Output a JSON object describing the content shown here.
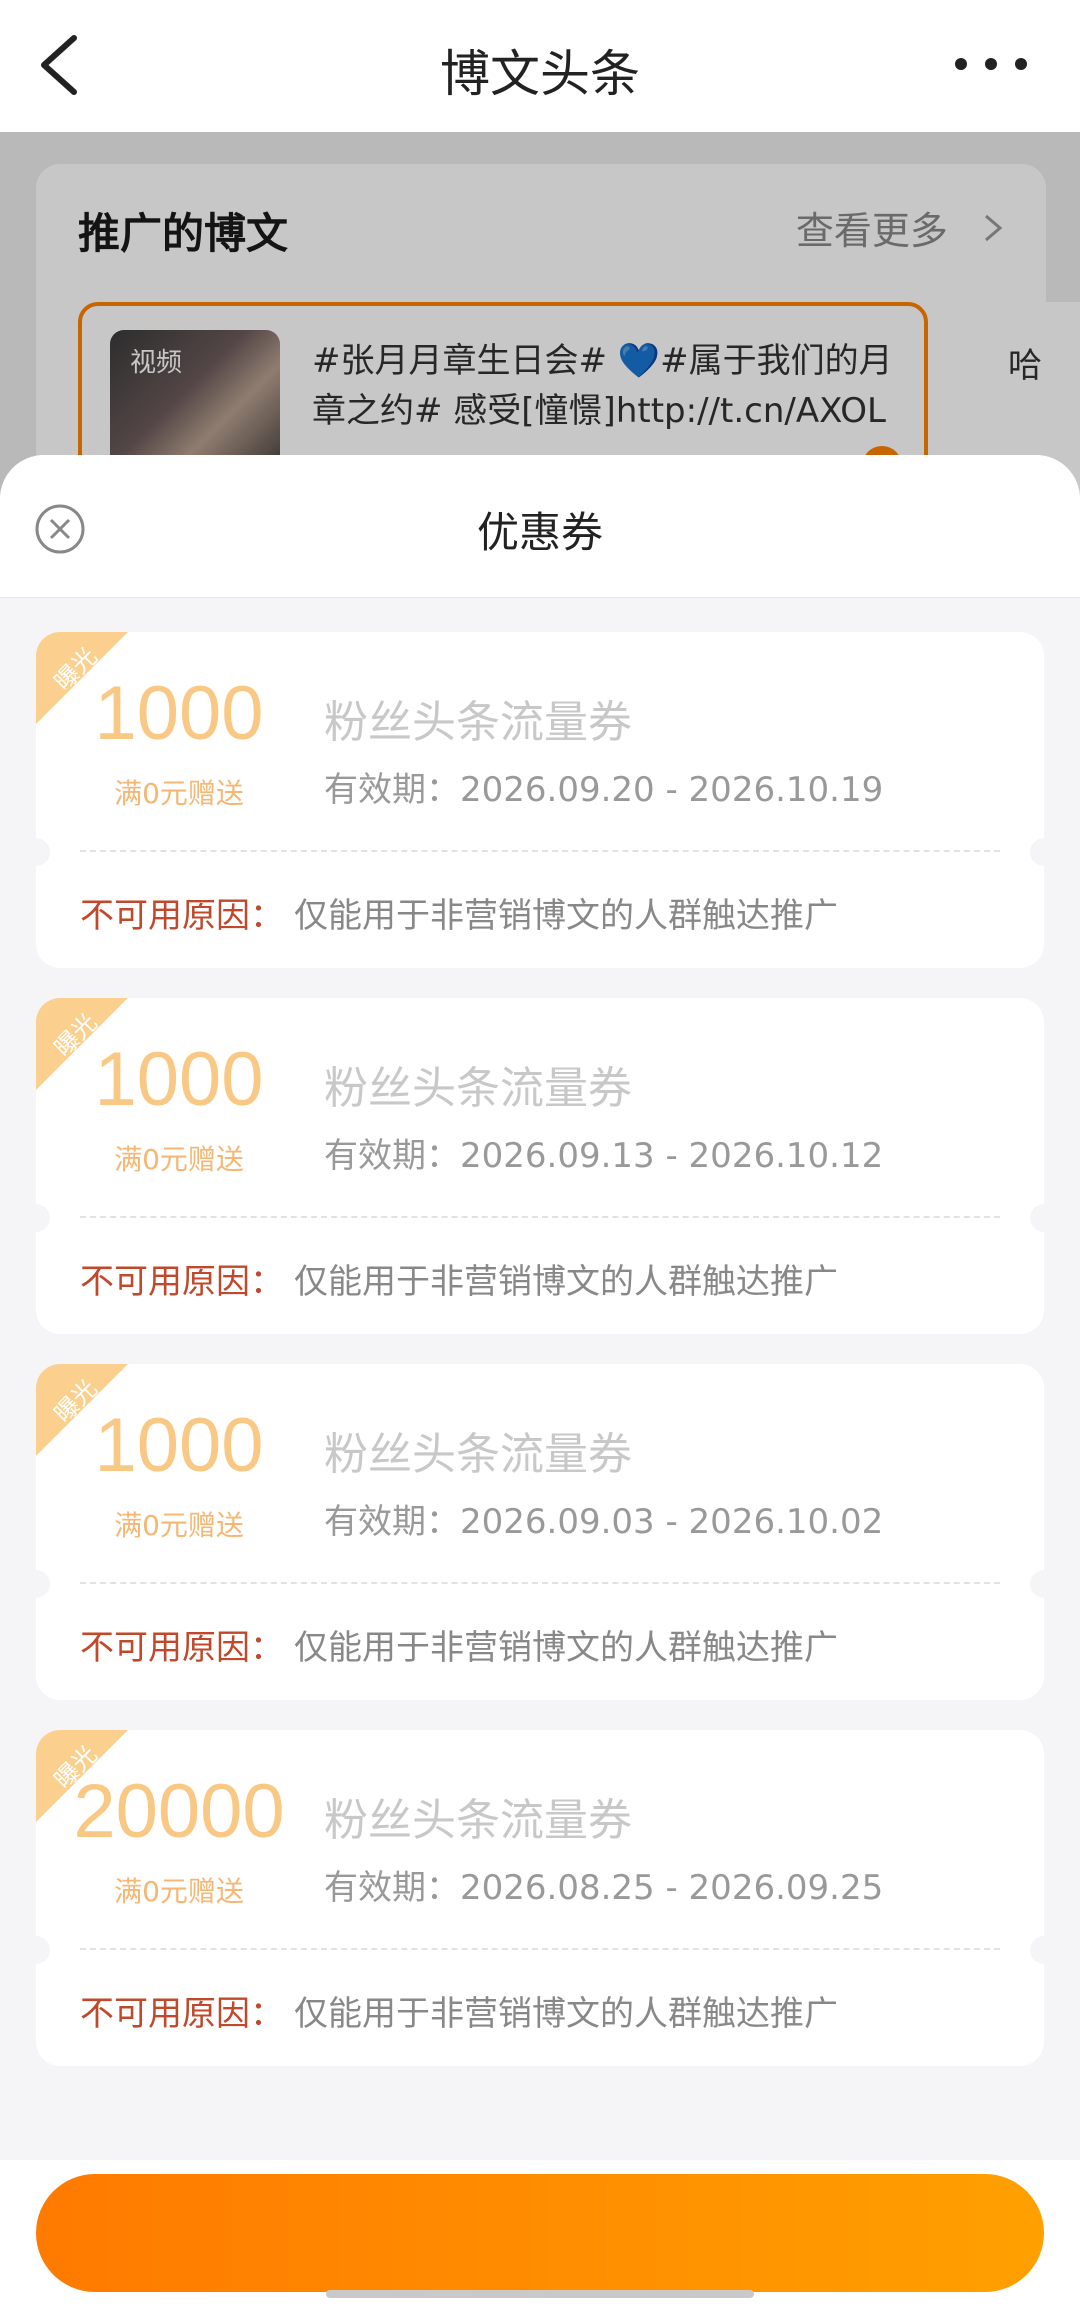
{
  "nav": {
    "title": "博文头条"
  },
  "promo": {
    "title": "推广的博文",
    "more_label": "查看更多",
    "post": {
      "thumb_tag": "视频",
      "text": "#张月月章生日会# 💙#属于我们的月章之约# 感受[憧憬]http://t.cn/AXOL"
    },
    "post2_text": "哈"
  },
  "sheet": {
    "title": "优惠券",
    "coupons": [
      {
        "badge": "曝光",
        "amount": "1000",
        "condition": "满0元赠送",
        "name": "粉丝头条流量券",
        "validity": "有效期：2026.09.20 - 2026.10.19",
        "reason_label": "不可用原因：",
        "reason": "仅能用于非营销博文的人群触达推广"
      },
      {
        "badge": "曝光",
        "amount": "1000",
        "condition": "满0元赠送",
        "name": "粉丝头条流量券",
        "validity": "有效期：2026.09.13 - 2026.10.12",
        "reason_label": "不可用原因：",
        "reason": "仅能用于非营销博文的人群触达推广"
      },
      {
        "badge": "曝光",
        "amount": "1000",
        "condition": "满0元赠送",
        "name": "粉丝头条流量券",
        "validity": "有效期：2026.09.03 - 2026.10.02",
        "reason_label": "不可用原因：",
        "reason": "仅能用于非营销博文的人群触达推广"
      },
      {
        "badge": "曝光",
        "amount": "20000",
        "condition": "满0元赠送",
        "name": "粉丝头条流量券",
        "validity": "有效期：2026.08.25 - 2026.09.25",
        "reason_label": "不可用原因：",
        "reason": "仅能用于非营销博文的人群触达推广"
      }
    ]
  },
  "footer": {
    "button_label": ""
  },
  "colors": {
    "accent": "#ff8200",
    "amount": "#f9c884",
    "reason_label": "#c0482b"
  }
}
